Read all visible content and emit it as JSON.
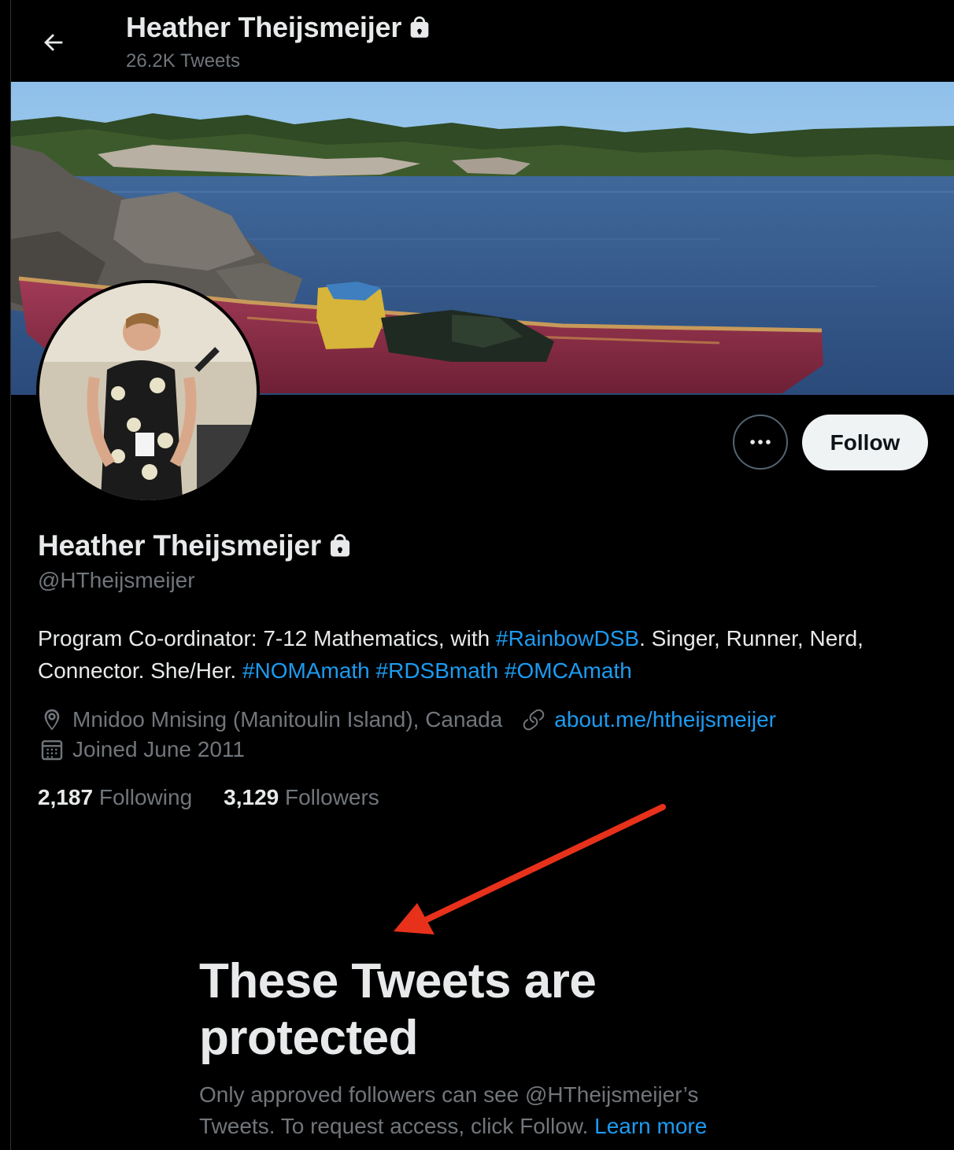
{
  "header": {
    "name": "Heather Theijsmeijer",
    "tweet_count": "26.2K Tweets"
  },
  "actions": {
    "follow_label": "Follow"
  },
  "profile": {
    "name": "Heather Theijsmeijer",
    "handle": "@HTheijsmeijer",
    "bio": {
      "t1": "Program Co-ordinator: 7-12 Mathematics, with ",
      "tag1": "#RainbowDSB",
      "t2": ". Singer, Runner, Nerd, Connector. She/Her. ",
      "tag2": "#NOMAmath",
      "tag3": "#RDSBmath",
      "tag4": "#OMCAmath"
    },
    "location": "Mnidoo Mnising (Manitoulin Island), Canada",
    "website": "about.me/htheijsmeijer",
    "joined": "Joined June 2011",
    "following_count": "2,187",
    "following_label": "Following",
    "followers_count": "3,129",
    "followers_label": "Followers"
  },
  "protected": {
    "title": "These Tweets are protected",
    "message": "Only approved followers can see @HTheijsmeijer’s Tweets. To request access, click Follow.",
    "learn_more": "Learn more"
  },
  "icons": {
    "back": "arrow-left-icon",
    "lock": "lock-icon",
    "more": "more-dots-icon",
    "location": "location-pin-icon",
    "link": "link-icon",
    "calendar": "calendar-icon"
  },
  "colors": {
    "background": "#000000",
    "text": "#e7e9ea",
    "muted": "#71767b",
    "link": "#1d9bf0",
    "annotation_arrow": "#e8311a"
  }
}
